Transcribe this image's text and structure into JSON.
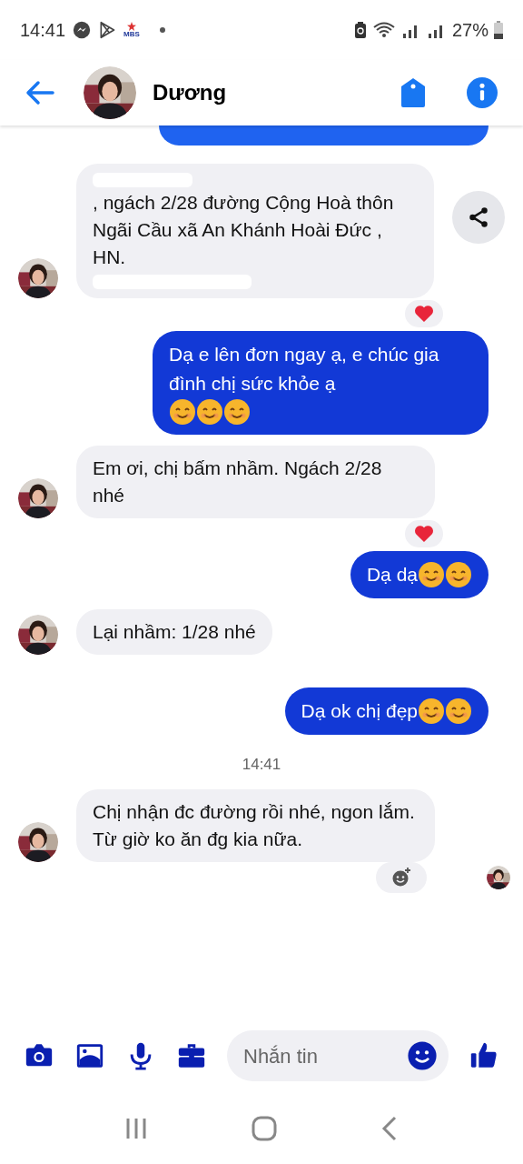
{
  "status_bar": {
    "time": "14:41",
    "app_badge": "MBS",
    "battery": "27%"
  },
  "header": {
    "name": "Dương"
  },
  "messages": [
    {
      "kind": "outgoing_cut"
    },
    {
      "kind": "incoming",
      "text": ", ngách 2/28 đường Cộng Hoà thôn Ngãi Cầu xã An Khánh Hoài Đức , HN.",
      "redacted": true,
      "share": true,
      "reaction": {
        "kind": "heart"
      },
      "seen": false
    },
    {
      "kind": "outgoing",
      "text": "Dạ e lên đơn ngay ạ, e chúc gia đình chị sức khỏe ạ",
      "emojis": [
        {
          "kind": "smile"
        },
        {
          "kind": "smile"
        },
        {
          "kind": "smile"
        }
      ]
    },
    {
      "kind": "incoming",
      "text": "Em ơi, chị bấm nhầm. Ngách 2/28 nhé",
      "redacted": false,
      "share": false,
      "reaction": {
        "kind": "heart"
      },
      "seen": false
    },
    {
      "kind": "outgoing",
      "text": "Dạ dạ",
      "emojis": [
        {
          "kind": "smile"
        },
        {
          "kind": "smile"
        }
      ]
    },
    {
      "kind": "incoming",
      "text": "Lại nhầm: 1/28 nhé",
      "redacted": false,
      "share": false,
      "seen": false
    },
    {
      "kind": "outgoing",
      "text": "Dạ ok chị đẹp",
      "emojis": [
        {
          "kind": "smile"
        },
        {
          "kind": "smile"
        }
      ]
    },
    {
      "kind": "timestamp",
      "text": "14:41"
    },
    {
      "kind": "incoming",
      "text": "Chị nhận đc đường rồi nhé, ngon lắm. Từ giờ ko ăn đg kia nữa.",
      "redacted": false,
      "share": false,
      "reaction": {
        "kind": "add"
      },
      "seen": true
    }
  ],
  "composer": {
    "placeholder": "Nhắn tin"
  }
}
